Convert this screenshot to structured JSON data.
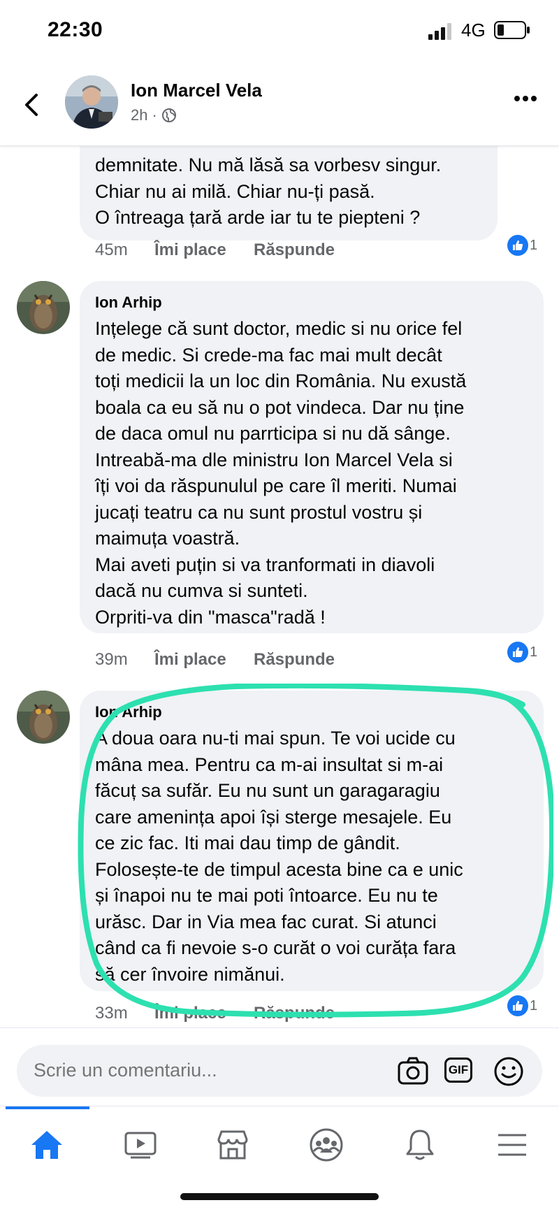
{
  "status": {
    "time": "22:30",
    "network": "4G"
  },
  "header": {
    "poster_name": "Ion Marcel Vela",
    "time_ago": "2h",
    "separator": "·"
  },
  "comments": [
    {
      "text": "demnitate. Nu mă lăsă sa vorbesv singur.\nChiar nu ai milă. Chiar nu-ți pasă.\n O întreaga țară arde iar tu te piepteni ?",
      "time": "45m",
      "like_label": "Îmi place",
      "reply_label": "Răspunde",
      "reactions": "1"
    },
    {
      "author": "Ion Arhip",
      "text": "Ințelege că sunt doctor, medic si nu orice fel\nde medic. Si crede-ma fac mai mult decât\ntoți medicii la un loc din România. Nu exustă\nboala ca eu să nu o pot vindeca. Dar nu ține\nde daca omul nu parrticipa si nu dă sânge.\nIntreabă-ma dle ministru Ion Marcel Vela si\nîți voi da răspunulul pe care îl meriti. Numai\njucați teatru ca nu sunt prostul vostru și\nmaimuța voastră.\nMai aveti puțin si va tranformati in diavoli\ndacă nu cumva si sunteti.\nOrpriti-va din \"masca\"radă !",
      "time": "39m",
      "like_label": "Îmi place",
      "reply_label": "Răspunde",
      "reactions": "1"
    },
    {
      "author": "Ion Arhip",
      "text": "A doua oara nu-ti mai spun. Te voi ucide cu\nmâna mea. Pentru ca m-ai insultat si m-ai\nfăcuț sa sufăr. Eu nu sunt un garagaragiu\ncare amenința apoi își sterge mesajele. Eu\nce zic fac. Iti mai dau timp de gândit.\nFolosește-te de timpul acesta bine ca e unic\nși înapoi nu te mai poti întoarce. Eu nu te\nurăsc. Dar in Via mea fac curat. Si atunci\ncând ca fi nevoie s-o curăt o voi curăța fara\nsă cer învoire nimănui.",
      "time": "33m",
      "like_label": "Îmi place",
      "reply_label": "Răspunde",
      "reactions": "1"
    }
  ],
  "composer": {
    "placeholder": "Scrie un comentariu...",
    "gif_label": "GIF"
  },
  "colors": {
    "accent": "#1877f2",
    "highlight": "#2de0b0",
    "bubble": "#f0f2f5"
  },
  "icons": [
    "back-arrow-icon",
    "globe-icon",
    "more-icon",
    "like-icon",
    "camera-icon",
    "gif-icon",
    "emoji-icon",
    "home-icon",
    "video-icon",
    "marketplace-icon",
    "groups-icon",
    "bell-icon",
    "menu-icon"
  ]
}
